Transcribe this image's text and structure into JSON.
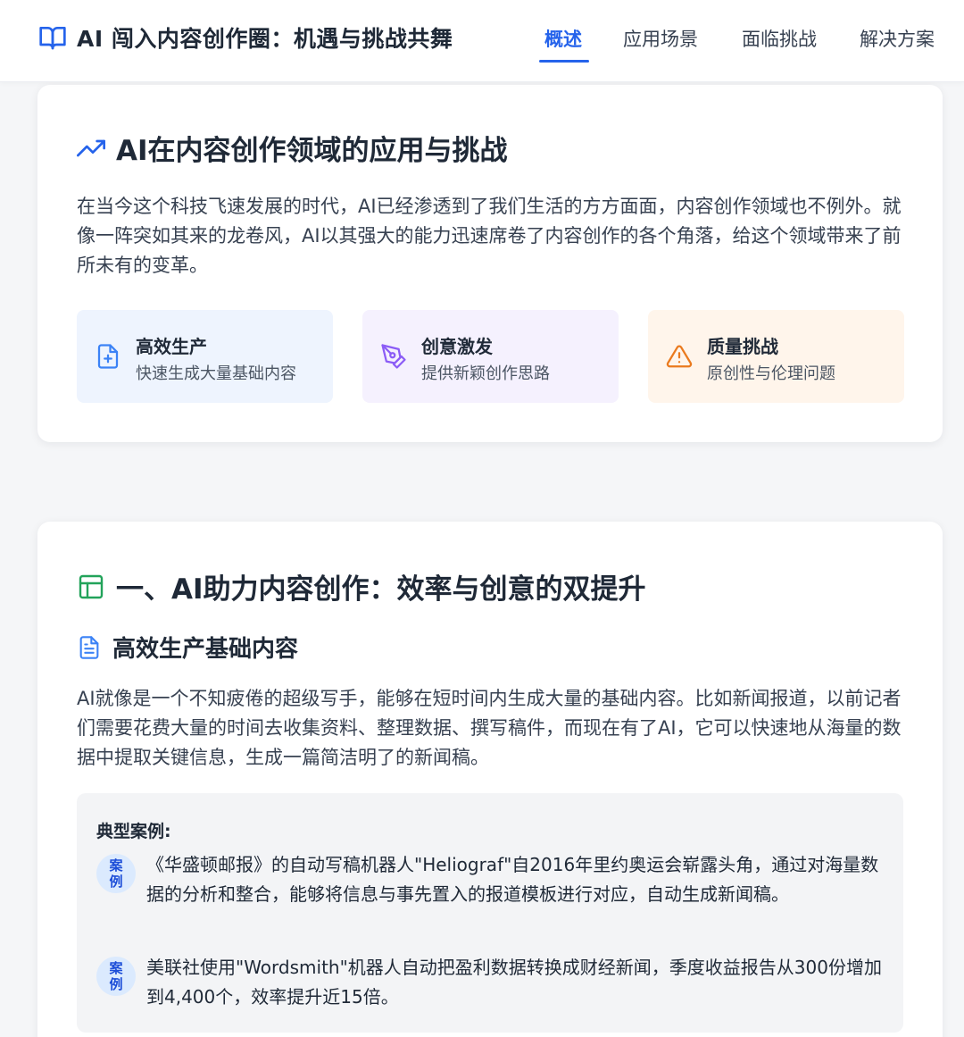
{
  "header": {
    "title": "AI 闯入内容创作圈：机遇与挑战共舞",
    "logo_icon": "book-open-icon",
    "nav": [
      {
        "label": "概述",
        "active": true
      },
      {
        "label": "应用场景",
        "active": false
      },
      {
        "label": "面临挑战",
        "active": false
      },
      {
        "label": "解决方案",
        "active": false
      }
    ]
  },
  "overview": {
    "icon": "trending-up-icon",
    "title": "AI在内容创作领域的应用与挑战",
    "intro": "在当今这个科技飞速发展的时代，AI已经渗透到了我们生活的方方面面，内容创作领域也不例外。就像一阵突如其来的龙卷风，AI以其强大的能力迅速席卷了内容创作的各个角落，给这个领域带来了前所未有的变革。",
    "features": [
      {
        "icon": "file-plus-icon",
        "title": "高效生产",
        "desc": "快速生成大量基础内容",
        "bg": "#eef4fe",
        "color": "#3b82f6"
      },
      {
        "icon": "pen-tool-icon",
        "title": "创意激发",
        "desc": "提供新颖创作思路",
        "bg": "#f5f1fe",
        "color": "#8b5cf6"
      },
      {
        "icon": "alert-triangle-icon",
        "title": "质量挑战",
        "desc": "原创性与伦理问题",
        "bg": "#fff5eb",
        "color": "#ea7a1e"
      }
    ]
  },
  "section1": {
    "icon": "layout-icon",
    "title": "一、AI助力内容创作：效率与创意的双提升",
    "subtitle": "高效生产基础内容",
    "subtitle_icon": "file-text-icon",
    "body": "AI就像是一个不知疲倦的超级写手，能够在短时间内生成大量的基础内容。比如新闻报道，以前记者们需要花费大量的时间去收集资料、整理数据、撰写稿件，而现在有了AI，它可以快速地从海量的数据中提取关键信息，生成一篇简洁明了的新闻稿。",
    "cases": {
      "heading": "典型案例:",
      "badge": "案例",
      "items": [
        "《华盛顿邮报》的自动写稿机器人\"Heliograf\"自2016年里约奥运会崭露头角，通过对海量数据的分析和整合，能够将信息与事先置入的报道模板进行对应，自动生成新闻稿。",
        "美联社使用\"Wordsmith\"机器人自动把盈利数据转换成财经新闻，季度收益报告从300份增加到4,400个，效率提升近15倍。"
      ]
    }
  },
  "colors": {
    "accent": "#2563eb",
    "section_icon_green": "#22a35a",
    "page_bg": "#f5f6f8"
  }
}
